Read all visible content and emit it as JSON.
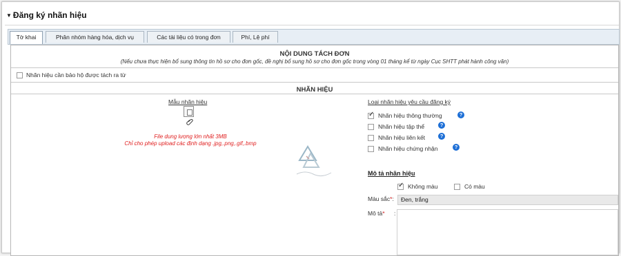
{
  "header": {
    "title": "Đăng ký nhãn hiệu"
  },
  "tabs": [
    {
      "label": "Tờ khai",
      "active": true
    },
    {
      "label": "Phân nhóm hàng hóa, dịch vụ",
      "active": false
    },
    {
      "label": "Các tài liệu có trong đơn",
      "active": false
    },
    {
      "label": "Phí, Lệ phí",
      "active": false
    }
  ],
  "tach_don": {
    "title": "NỘI DUNG TÁCH ĐƠN",
    "note": "(Nếu chưa thực hiện bổ sung thông tin hồ sơ cho đơn gốc, đề nghị bổ sung hồ sơ cho đơn gốc trong vòng 01 tháng kể từ ngày Cục SHTT phát hành công văn)",
    "checkbox_label": "Nhãn hiệu cần bảo hộ được tách ra từ",
    "checkbox_checked": false
  },
  "nhan_hieu": {
    "title": "NHÃN HIỆU",
    "mau_label": "Mẫu nhãn hiệu",
    "file_note_1": "File dung lượng lớn nhất 3MB",
    "file_note_2": "Chỉ cho phép upload các định dạng .jpg,.png,.gif,.bmp",
    "loai_label": "Loại nhãn hiệu yêu cầu đăng ký",
    "loai_options": [
      {
        "label": "Nhãn hiệu thông thường",
        "checked": true,
        "help": true
      },
      {
        "label": "Nhãn hiệu tập thể",
        "checked": false,
        "help": true
      },
      {
        "label": "Nhãn hiệu liên kết",
        "checked": false,
        "help": true
      },
      {
        "label": "Nhãn hiệu chứng nhận",
        "checked": false,
        "help": true
      }
    ]
  },
  "mo_ta": {
    "title": "Mô tả nhãn hiệu",
    "khong_mau_label": "Không màu",
    "khong_mau_checked": true,
    "co_mau_label": "Có màu",
    "co_mau_checked": false,
    "mau_sac_label": "Màu sắc",
    "mau_sac_value": "Đen, trắng",
    "mo_ta_label": "Mô tả",
    "required_mark": "*",
    "colon": ":",
    "mo_ta_value": ""
  },
  "icons": {
    "help": "question-circle-icon",
    "upload": "document-icon",
    "attach": "paperclip-icon",
    "help_color": "#1d6fd6",
    "error_color": "#e02020"
  }
}
